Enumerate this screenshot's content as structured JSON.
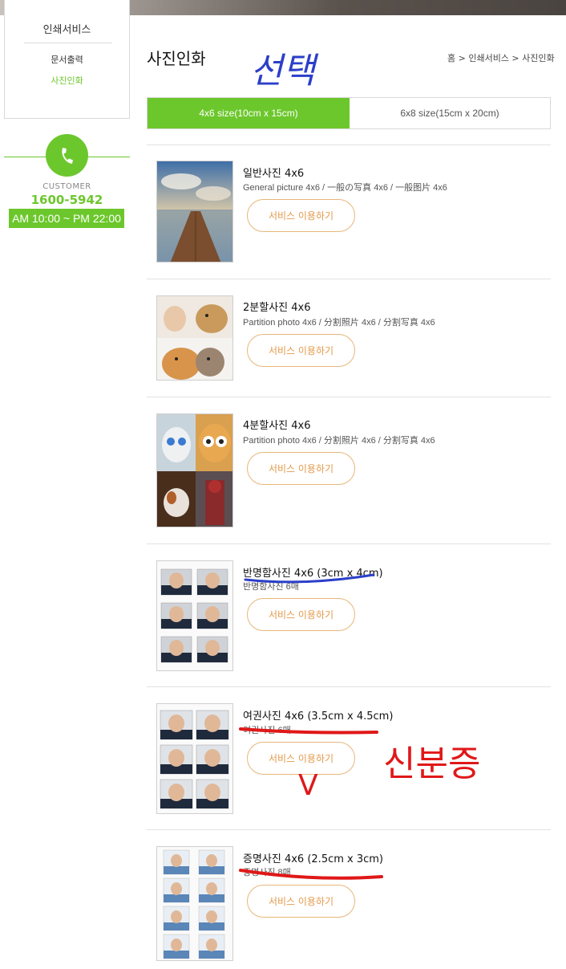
{
  "sidebar": {
    "title": "인쇄서비스",
    "items": [
      {
        "label": "문서출력",
        "active": false
      },
      {
        "label": "사진인화",
        "active": true
      }
    ],
    "customer": {
      "label": "CUSTOMER",
      "phone": "1600-5942",
      "hours": "AM 10:00 ~ PM 22:00"
    }
  },
  "page": {
    "title": "사진인화",
    "breadcrumb": "홈 > 인쇄서비스 > 사진인화"
  },
  "tabs": [
    {
      "label": "4x6 size(10cm x 15cm)",
      "active": true
    },
    {
      "label": "6x8 size(15cm x 20cm)",
      "active": false
    }
  ],
  "products": [
    {
      "title": "일반사진 4x6",
      "subtitle": "General picture 4x6 / 一般の写真 4x6 / 一般图片 4x6",
      "button": "서비스 이용하기"
    },
    {
      "title": "2분할사진 4x6",
      "subtitle": "Partition photo 4x6 / 分割照片 4x6 / 分割写真 4x6",
      "button": "서비스 이용하기"
    },
    {
      "title": "4분할사진 4x6",
      "subtitle": "Partition photo 4x6 / 分割照片 4x6 / 分割写真 4x6",
      "button": "서비스 이용하기"
    },
    {
      "title": "반명함사진 4x6 (3cm x 4cm)",
      "subtitle": "반명함사진 6매",
      "button": "서비스 이용하기"
    },
    {
      "title": "여권사진 4x6 (3.5cm x 4.5cm)",
      "subtitle": "여권사진 6매",
      "button": "서비스 이용하기"
    },
    {
      "title": "증명사진 4x6 (2.5cm x 3cm)",
      "subtitle": "증명사진 8매",
      "button": "서비스 이용하기"
    }
  ],
  "annotations": {
    "blue_text": "선택",
    "red_text": "신분증",
    "red_mark": "V",
    "colors": {
      "blue": "#2b3fc9",
      "red": "#e01818"
    }
  },
  "colors": {
    "accent": "#6cc72c",
    "button_text": "#e39a4a",
    "button_border": "#e8b67a"
  }
}
